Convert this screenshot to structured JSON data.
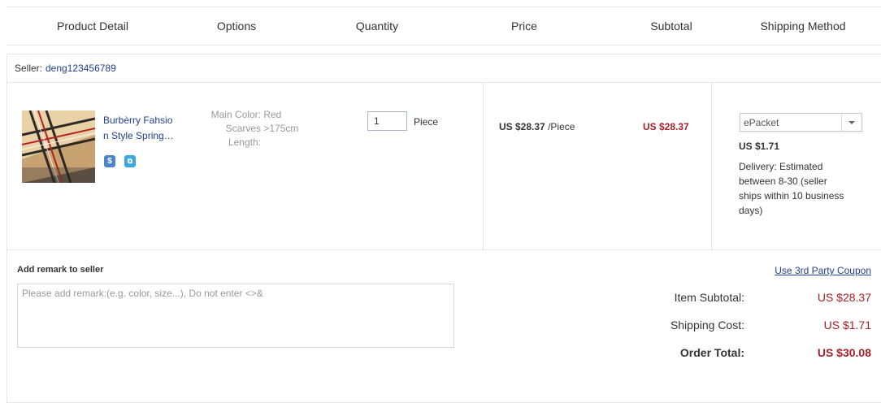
{
  "header": {
    "product_detail": "Product Detail",
    "options": "Options",
    "quantity": "Quantity",
    "price": "Price",
    "subtotal": "Subtotal",
    "shipping_method": "Shipping Method"
  },
  "seller": {
    "label": "Seller:",
    "name": "deng123456789"
  },
  "item": {
    "title_line1": "Burbèrry Fahsio",
    "title_line2": "n Style Spring…",
    "badge1": "$",
    "badge2": "⧉",
    "options": [
      {
        "key": "Main Color:",
        "value": "Red"
      },
      {
        "key": "Scarves",
        "value": ">175cm"
      },
      {
        "key": "Length:",
        "value": ""
      }
    ],
    "quantity": "1",
    "unit": "Piece",
    "price": "US $28.37",
    "price_unit": "/Piece",
    "subtotal": "US $28.37"
  },
  "shipping": {
    "selected": "ePacket",
    "cost": "US $1.71",
    "delivery": [
      "Delivery: Estimated",
      "between 8-30 (seller",
      "ships within 10 business",
      "days)"
    ]
  },
  "remark": {
    "label": "Add remark to seller",
    "placeholder": "Please add remark:(e.g. color, size...), Do not enter <>&"
  },
  "coupon_link": "Use 3rd Party Coupon",
  "summary": {
    "item_subtotal_label": "Item Subtotal:",
    "item_subtotal": "US $28.37",
    "shipping_cost_label": "Shipping Cost:",
    "shipping_cost": "US $1.71",
    "order_total_label": "Order Total:",
    "order_total": "US $30.08"
  },
  "colors": {
    "accent_red": "#a8202a",
    "link_blue": "#1f3f8f",
    "badge_blue": "#4a86c8",
    "badge_cyan": "#39a7e0"
  }
}
